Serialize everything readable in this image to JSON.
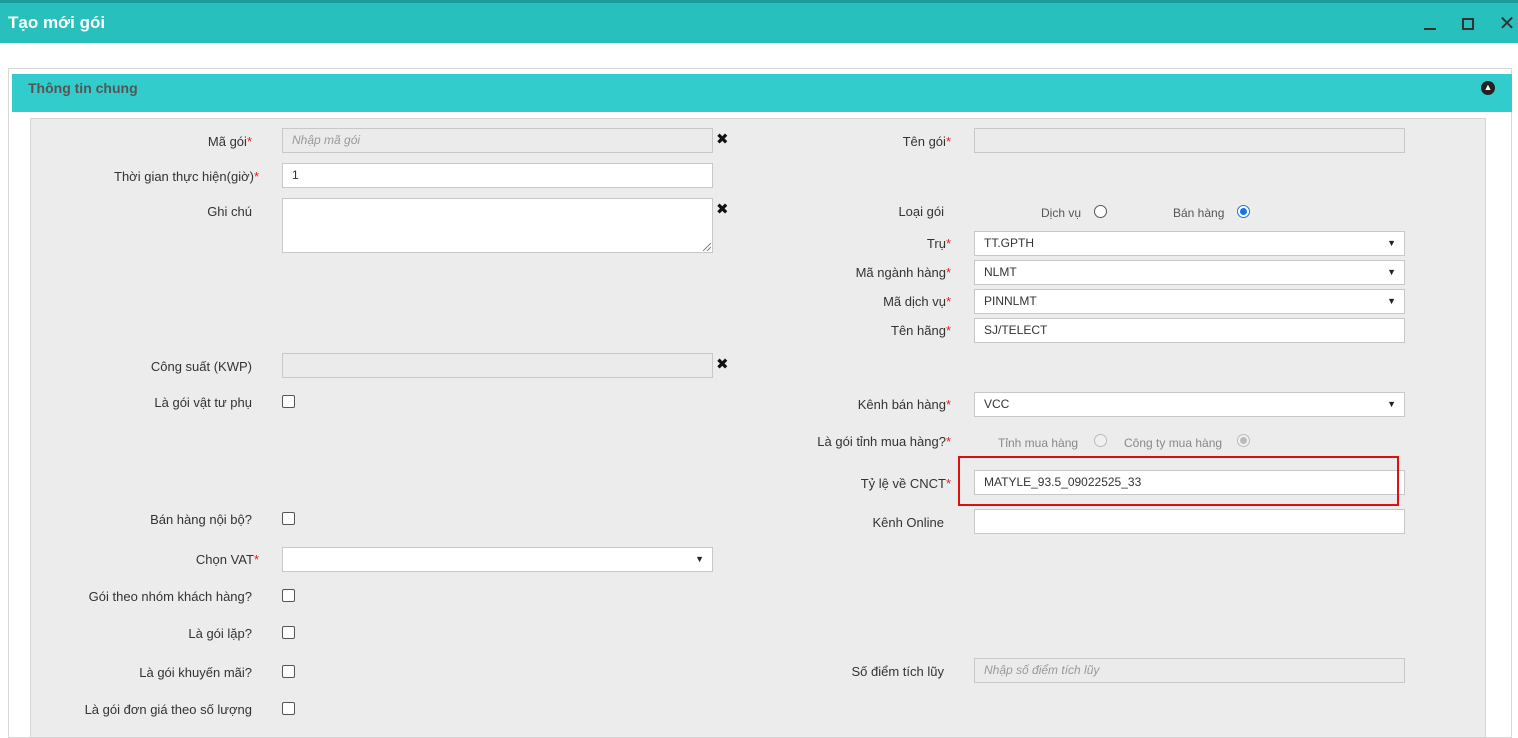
{
  "window": {
    "title": "Tạo mới gói",
    "minimize_label": "",
    "close_glyph": "✕"
  },
  "section": {
    "title": "Thông tin chung",
    "collapse_glyph": "▲"
  },
  "required_mark": "*",
  "fields": {
    "ma_goi": {
      "label": "Mã gói",
      "placeholder": "Nhập mã gói"
    },
    "ten_goi": {
      "label": "Tên gói",
      "value": ""
    },
    "thoi_gian": {
      "label": "Thời gian thực hiện(giờ)",
      "value": "1"
    },
    "ghi_chu": {
      "label": "Ghi chú",
      "value": ""
    },
    "loai_goi": {
      "label": "Loại gói",
      "options": [
        "Dịch vụ",
        "Bán hàng"
      ],
      "selected": "Bán hàng"
    },
    "tru": {
      "label": "Trụ",
      "value": "TT.GPTH"
    },
    "ma_nganh_hang": {
      "label": "Mã ngành hàng",
      "value": "NLMT"
    },
    "ma_dich_vu": {
      "label": "Mã dịch vụ",
      "value": "PINNLMT"
    },
    "ten_hang": {
      "label": "Tên hãng",
      "value": "SJ/TELECT"
    },
    "cong_suat": {
      "label": "Công suất (KWP)",
      "value": ""
    },
    "la_goi_vat_tu_phu": {
      "label": "Là gói vật tư phụ"
    },
    "kenh_ban_hang": {
      "label": "Kênh bán hàng",
      "value": "VCC"
    },
    "la_goi_tinh_mua_hang": {
      "label": "Là gói tỉnh mua hàng?",
      "options": [
        "Tỉnh mua hàng",
        "Công ty mua hàng"
      ],
      "selected": "Công ty mua hàng"
    },
    "ty_le_ve_cnct": {
      "label": "Tỷ lệ về CNCT",
      "value": "MATYLE_93.5_09022525_33"
    },
    "ban_hang_noi_bo": {
      "label": "Bán hàng nội bộ?"
    },
    "kenh_online": {
      "label": "Kênh Online",
      "value": ""
    },
    "chon_vat": {
      "label": "Chọn VAT",
      "value": ""
    },
    "goi_theo_nhom_kh": {
      "label": "Gói theo nhóm khách hàng?"
    },
    "la_goi_lap": {
      "label": "Là gói lặp?"
    },
    "la_goi_khuyen_mai": {
      "label": "Là gói khuyến mãi?"
    },
    "so_diem_tich_luy": {
      "label": "Số điểm tích lũy",
      "placeholder": "Nhập số điểm tích lũy"
    },
    "la_goi_don_gia": {
      "label": "Là gói đơn giá theo số lượng"
    }
  },
  "icons": {
    "clear": "✖",
    "dropdown": "▼"
  },
  "colors": {
    "header": "#27c0bc",
    "section": "#33cccc",
    "highlight": "#e01010",
    "required": "#e02020"
  }
}
